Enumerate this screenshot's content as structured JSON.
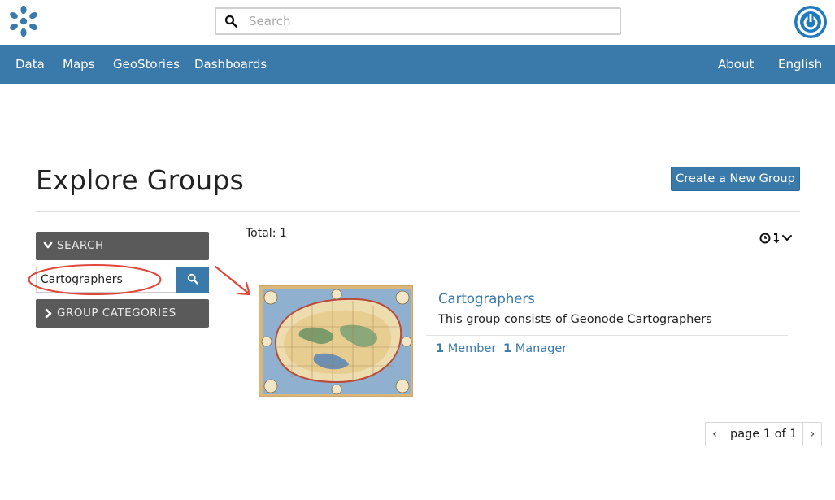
{
  "header": {
    "search_placeholder": "Search",
    "logo_icon": "geonode-logo-icon",
    "power_icon": "power-icon"
  },
  "nav": {
    "left": [
      "Data",
      "Maps",
      "GeoStories",
      "Dashboards"
    ],
    "right": [
      "About",
      "English"
    ]
  },
  "page": {
    "title": "Explore Groups",
    "create_label": "Create a New Group"
  },
  "sidebar": {
    "search_heading": "SEARCH",
    "search_value": "Cartographers",
    "categories_heading": "GROUP CATEGORIES"
  },
  "results": {
    "total_text": "Total: 1",
    "group": {
      "title": "Cartographers",
      "description": "This group consists of Geonode Cartographers",
      "members_count": "1",
      "members_label": "Member",
      "managers_count": "1",
      "managers_label": "Manager"
    },
    "pagination": {
      "prev": "‹",
      "info": "page 1 of 1",
      "next": "›"
    }
  },
  "colors": {
    "brand_blue": "#397aab",
    "panel_gray": "#5a5a5a",
    "annotation_red": "#e0463c"
  }
}
